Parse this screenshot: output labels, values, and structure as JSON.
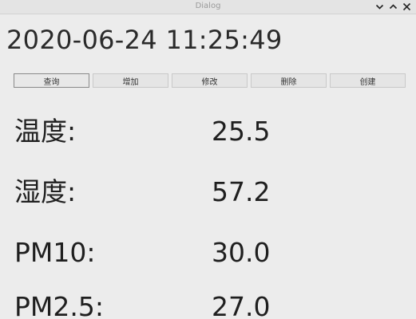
{
  "window": {
    "title": "Dialog"
  },
  "datetime": "2020-06-24 11:25:49",
  "toolbar": {
    "buttons": [
      {
        "label": "查询"
      },
      {
        "label": "增加"
      },
      {
        "label": "修改"
      },
      {
        "label": "删除"
      },
      {
        "label": "创建"
      }
    ]
  },
  "readings": [
    {
      "label": "温度:",
      "value": "25.5"
    },
    {
      "label": "湿度:",
      "value": "57.2"
    },
    {
      "label": "PM10:",
      "value": "30.0"
    },
    {
      "label": "PM2.5:",
      "value": "27.0"
    }
  ],
  "icons": {
    "minimize": "chevron-down-icon",
    "maximize": "chevron-up-icon",
    "close": "close-icon"
  }
}
